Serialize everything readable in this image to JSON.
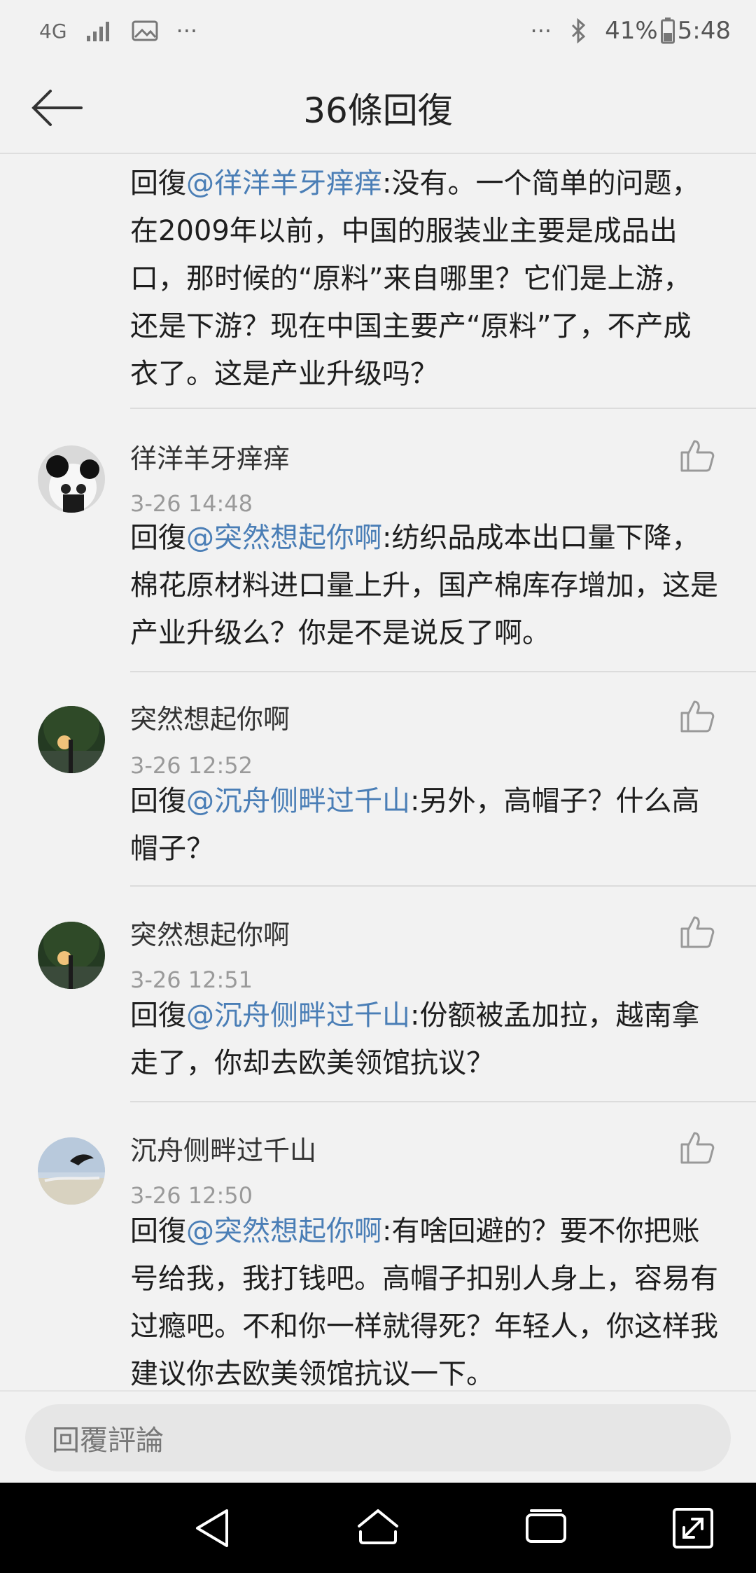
{
  "status_bar": {
    "network": "4G",
    "overflow_left": "···",
    "overflow_right": "···",
    "battery": "41%",
    "time": "5:48"
  },
  "header": {
    "title": "36條回復"
  },
  "first_reply": {
    "prefix": "回復",
    "mention": "@徉洋羊牙痒痒",
    "text": ":没有。一个简单的问题，在2009年以前，中国的服装业主要是成品出口，那时候的“原料”来自哪里？它们是上游，还是下游？现在中国主要产“原料”了，不产成衣了。这是产业升级吗？"
  },
  "comments": [
    {
      "author": "徉洋羊牙痒痒",
      "time": "3-26 14:48",
      "prefix": "回復",
      "mention": "@突然想起你啊",
      "text": ":纺织品成本出口量下降，棉花原材料进口量上升，国产棉库存增加，这是产业升级么？你是不是说反了啊。",
      "avatar": "panda-avatar"
    },
    {
      "author": "突然想起你啊",
      "time": "3-26 12:52",
      "prefix": "回復",
      "mention": "@沉舟侧畔过千山",
      "text": ":另外，高帽子？什么高帽子？",
      "avatar": "sunset-tree-avatar"
    },
    {
      "author": "突然想起你啊",
      "time": "3-26 12:51",
      "prefix": "回復",
      "mention": "@沉舟侧畔过千山",
      "text": ":份额被孟加拉，越南拿走了，你却去欧美领馆抗议？",
      "avatar": "sunset-tree-avatar"
    },
    {
      "author": "沉舟侧畔过千山",
      "time": "3-26 12:50",
      "prefix": "回復",
      "mention": "@突然想起你啊",
      "text": ":有啥回避的？要不你把账号给我，我打钱吧。高帽子扣别人身上，容易有过瘾吧。不和你一样就得死？年轻人，你这样我建议你去欧美领馆抗议一下。",
      "avatar": "dolphin-sea-avatar"
    }
  ],
  "input": {
    "placeholder": "回覆評論"
  },
  "colors": {
    "mention": "#4a7eb6",
    "background": "#f2f2f2",
    "nav": "#000000"
  }
}
